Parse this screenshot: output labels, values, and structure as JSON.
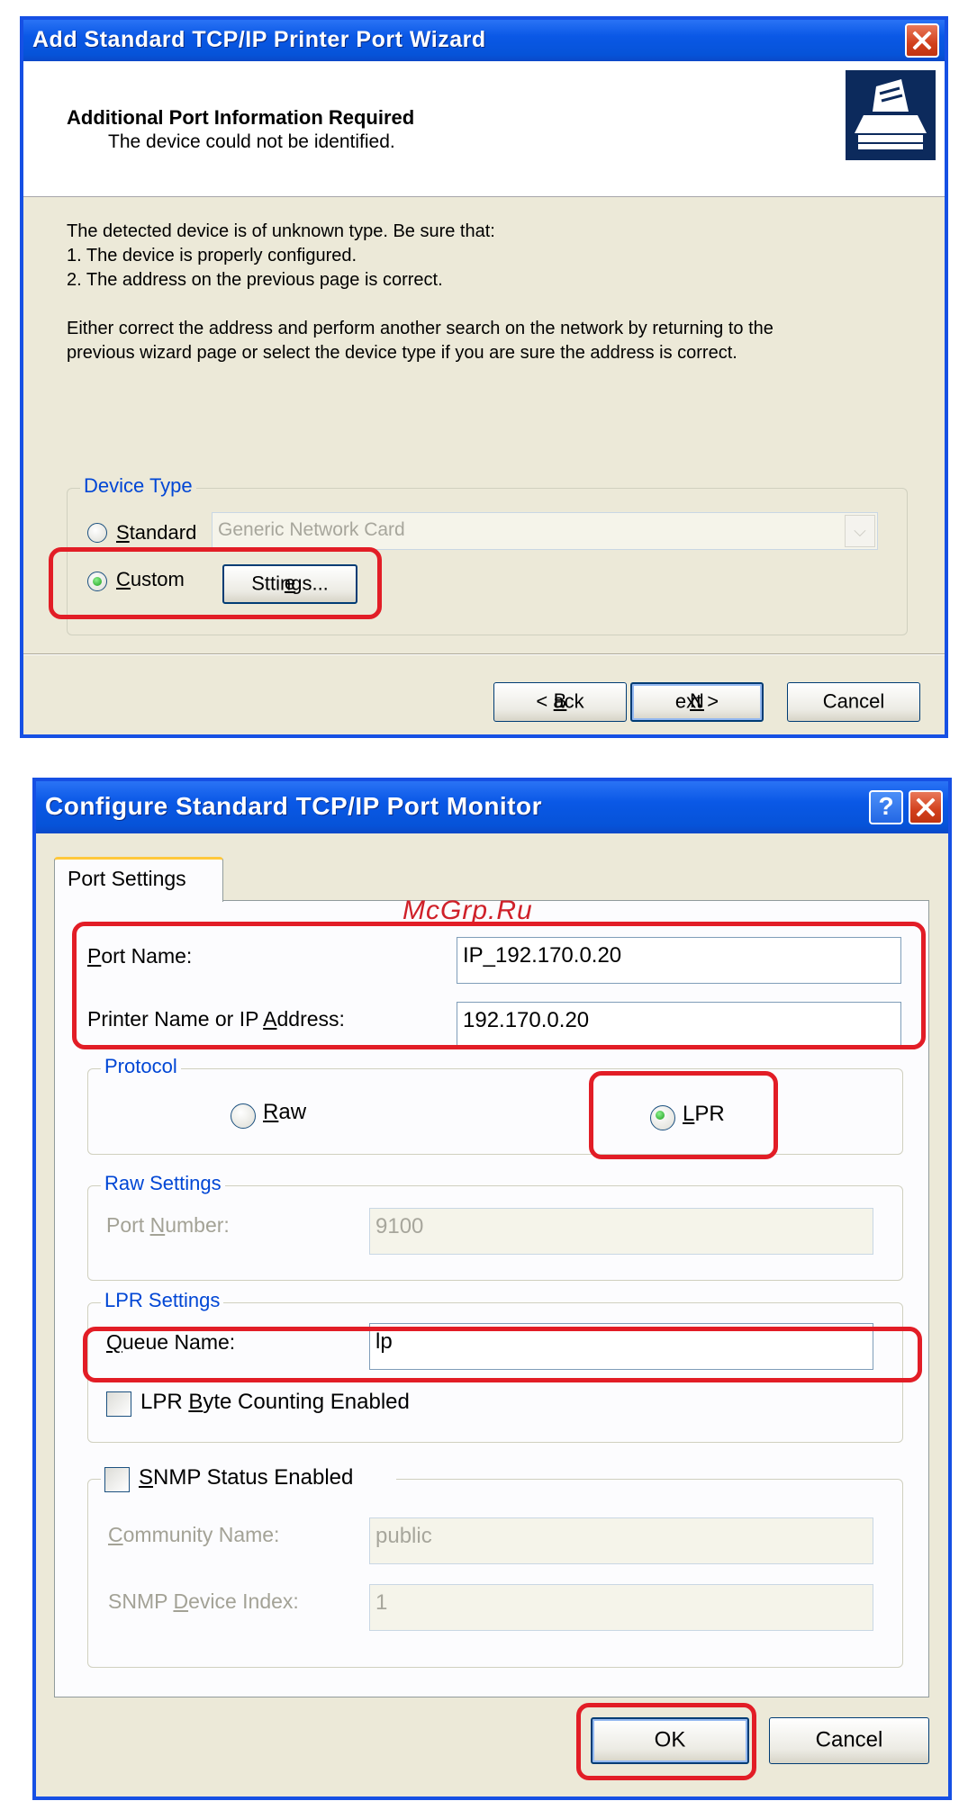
{
  "wizard": {
    "title": "Add Standard TCP/IP Printer Port Wizard",
    "header_title": "Additional Port Information Required",
    "header_subtitle": "The device could not be identified.",
    "body_line1": "The detected device is of unknown type.  Be sure that:",
    "body_line2": "1. The device is properly configured.",
    "body_line3": "2.  The address on the previous page is correct.",
    "body_para2_line1": "Either correct the address and perform another search on the network by returning to the",
    "body_para2_line2": "previous wizard page or select the device type if you are sure the address is correct.",
    "device_type": {
      "legend": "Device Type",
      "standard_label": "Standard",
      "standard_selected": false,
      "standard_dropdown_value": "Generic Network Card",
      "custom_label": "Custom",
      "custom_selected": true,
      "settings_button": "Settings..."
    },
    "buttons": {
      "back": "< Back",
      "next": "Next >",
      "cancel": "Cancel"
    }
  },
  "port_monitor": {
    "title": "Configure Standard TCP/IP Port Monitor",
    "tab": "Port Settings",
    "watermark": "McGrp.Ru",
    "port_name_label": "Port Name:",
    "port_name_value": "IP_192.170.0.20",
    "printer_address_label": "Printer Name or IP Address:",
    "printer_address_value": "192.170.0.20",
    "protocol": {
      "legend": "Protocol",
      "raw_label": "Raw",
      "raw_selected": false,
      "lpr_label": "LPR",
      "lpr_selected": true
    },
    "raw_settings": {
      "legend": "Raw Settings",
      "port_number_label": "Port Number:",
      "port_number_value": "9100"
    },
    "lpr_settings": {
      "legend": "LPR Settings",
      "queue_name_label": "Queue Name:",
      "queue_name_value": "lp",
      "byte_counting_label": "LPR Byte Counting Enabled",
      "byte_counting_checked": false
    },
    "snmp": {
      "label": "SNMP Status Enabled",
      "checked": false,
      "community_label": "Community Name:",
      "community_value": "public",
      "device_index_label": "SNMP Device Index:",
      "device_index_value": "1"
    },
    "buttons": {
      "ok": "OK",
      "cancel": "Cancel"
    }
  },
  "colors": {
    "highlight": "#e21d26",
    "titlebar": "#0a58e6",
    "legend_text": "#0046d5",
    "dialog_bg": "#ece9d8"
  }
}
